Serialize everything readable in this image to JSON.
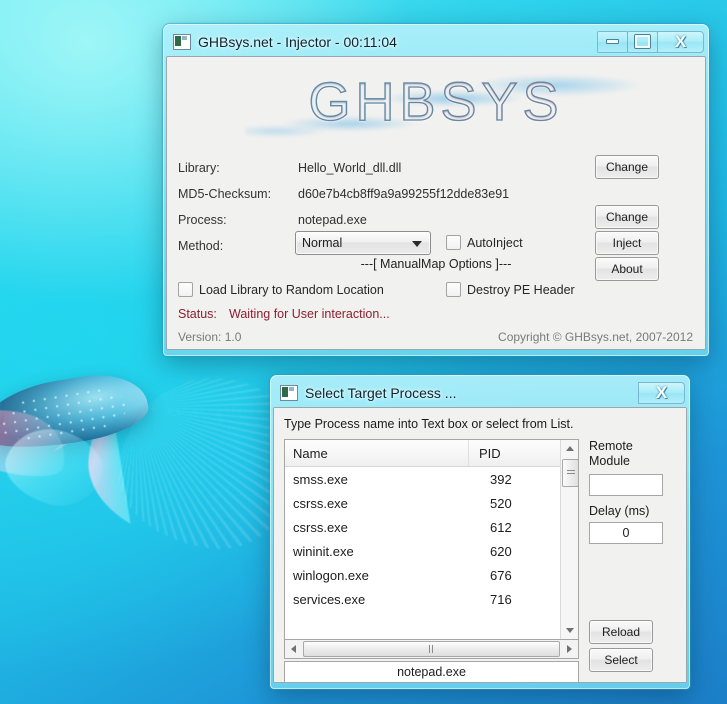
{
  "main_window": {
    "title": "GHBsys.net - Injector - 00:11:04",
    "icon": "app-icon",
    "controls": {
      "minimize": "–",
      "maximize": "❐",
      "close": "X"
    },
    "logo_text": "GHBSYS",
    "fields": [
      {
        "label": "Library:",
        "value": "Hello_World_dll.dll"
      },
      {
        "label": "MD5-Checksum:",
        "value": "d60e7b4cb8ff9a9a99255f12dde83e91"
      },
      {
        "label": "Process:",
        "value": "notepad.exe"
      },
      {
        "label": "Method:",
        "value": "Normal"
      }
    ],
    "method_selected": "Normal",
    "method_options": [
      "Normal"
    ],
    "auto_inject_label": "AutoInject",
    "auto_inject_checked": false,
    "manualmap_header": "---[ ManualMap Options ]---",
    "random_location_label": "Load Library to Random Location",
    "random_location_checked": false,
    "destroy_pe_label": "Destroy PE Header",
    "destroy_pe_checked": false,
    "status_label": "Status:",
    "status_value": "Waiting for User interaction...",
    "status_color": "#8c1f2f",
    "version": "Version: 1.0",
    "copyright": "Copyright © GHBsys.net, 2007-2012",
    "buttons": {
      "change_library": "Change",
      "change_process": "Change",
      "inject": "Inject",
      "about": "About"
    }
  },
  "dialog": {
    "title": "Select Target Process ...",
    "icon": "app-icon",
    "controls": {
      "close": "X"
    },
    "hint": "Type Process name into Text box or select from List.",
    "columns": [
      "Name",
      "PID"
    ],
    "rows": [
      {
        "name": "smss.exe",
        "pid": "392"
      },
      {
        "name": "csrss.exe",
        "pid": "520"
      },
      {
        "name": "csrss.exe",
        "pid": "612"
      },
      {
        "name": "wininit.exe",
        "pid": "620"
      },
      {
        "name": "winlogon.exe",
        "pid": "676"
      },
      {
        "name": "services.exe",
        "pid": "716"
      }
    ],
    "process_input_value": "notepad.exe",
    "remote_module_label_line1": "Remote",
    "remote_module_label_line2": "Module",
    "remote_module_value": "",
    "delay_label": "Delay (ms)",
    "delay_value": "0",
    "buttons": {
      "reload": "Reload",
      "select": "Select"
    }
  }
}
